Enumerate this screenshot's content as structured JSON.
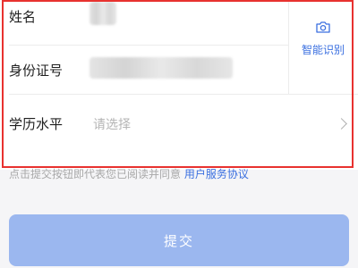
{
  "form": {
    "name_label": "姓名",
    "id_label": "身份证号",
    "education_label": "学历水平",
    "education_placeholder": "请选择",
    "smart_recognize_label": "智能识别"
  },
  "agreement": {
    "prefix": "点击提交按钮即代表您已阅读并同意",
    "link_text": "用户服务协议"
  },
  "submit_label": "提交",
  "colors": {
    "accent": "#3a6fe0",
    "button_disabled": "#9bb7ef",
    "highlight_border": "#e8322f"
  },
  "icons": [
    "camera-icon",
    "chevron-right-icon"
  ]
}
